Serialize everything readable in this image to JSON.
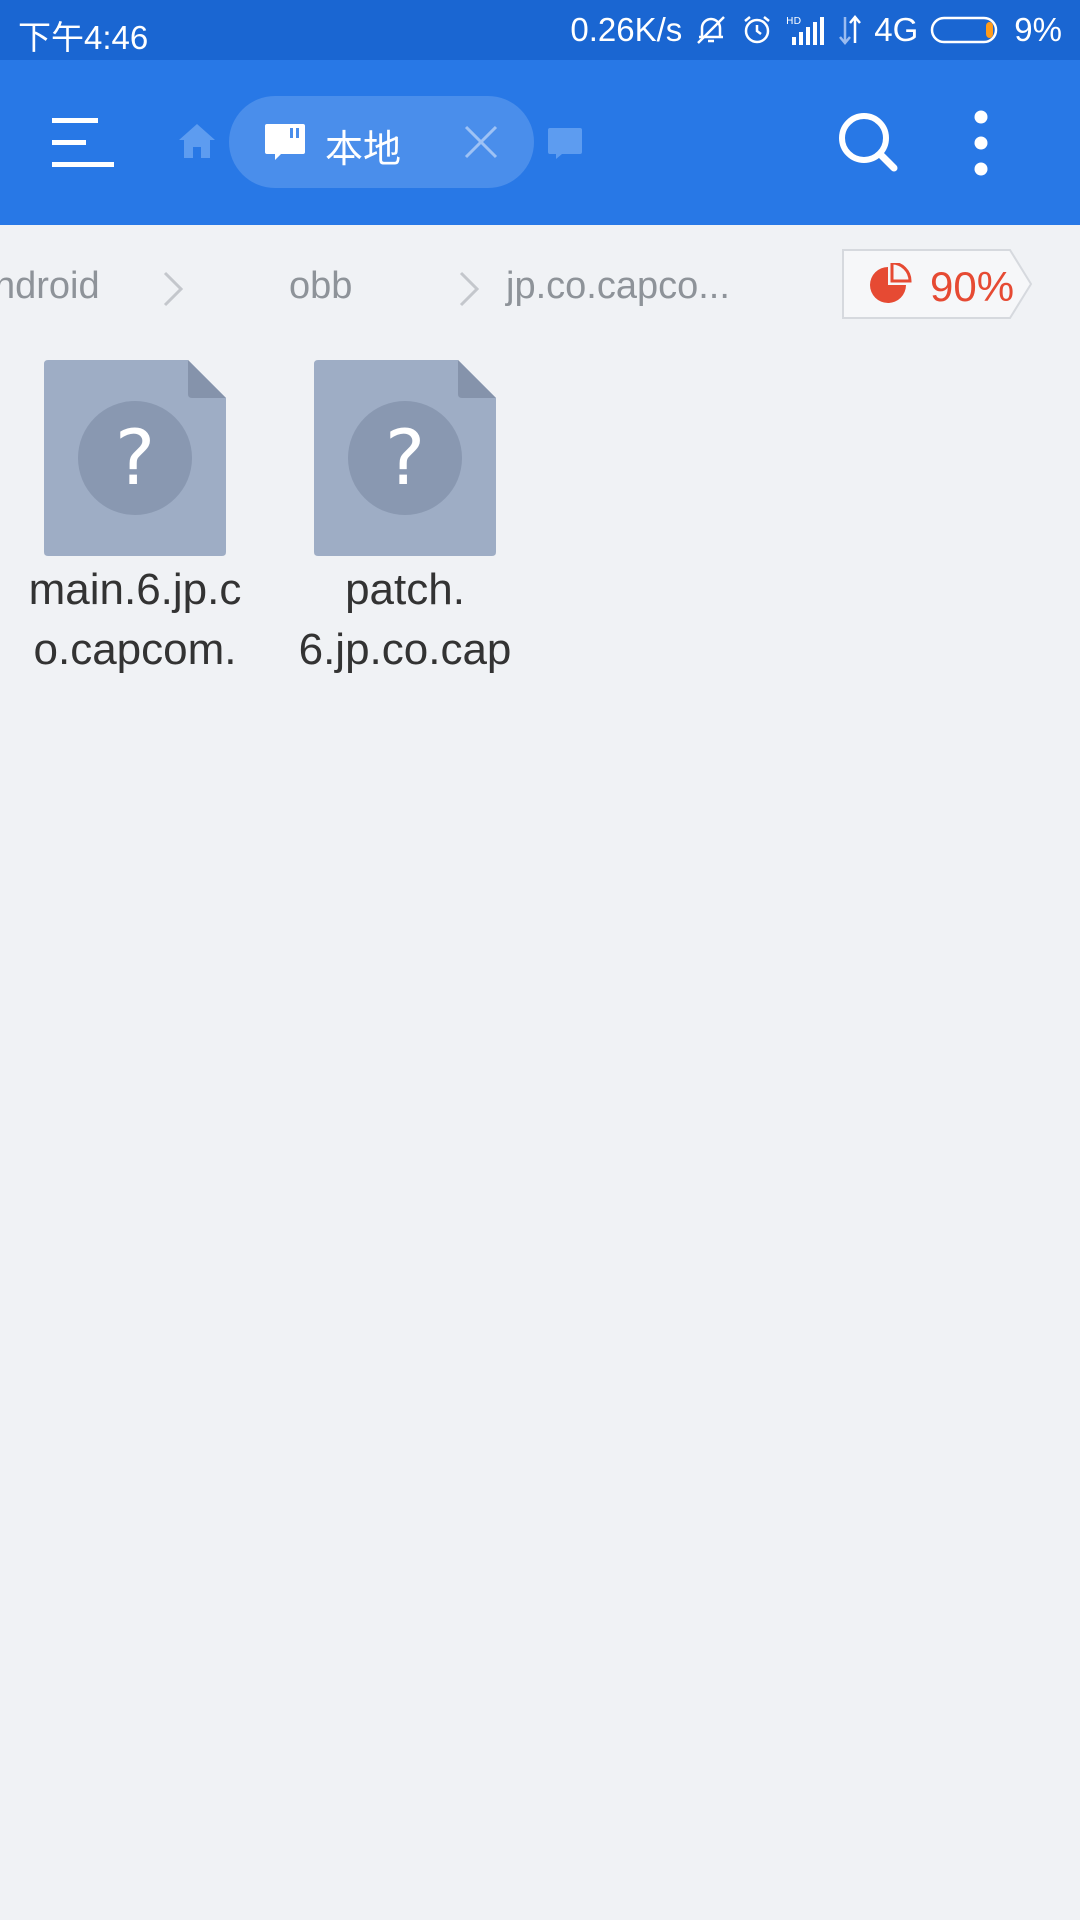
{
  "status_bar": {
    "time": "下午4:46",
    "net_speed": "0.26K/s",
    "network_type": "4G",
    "battery": "9%",
    "icons": [
      "mute-bell-icon",
      "alarm-icon",
      "hd-signal-icon",
      "data-arrows-icon",
      "battery-icon"
    ]
  },
  "toolbar": {
    "tab_label": "本地",
    "icons": [
      "menu-icon",
      "home-icon",
      "sd-card-icon",
      "close-icon",
      "search-icon",
      "more-vert-icon"
    ],
    "accent_color": "#2878e6"
  },
  "breadcrumb": {
    "items": [
      "ndroid",
      "obb",
      "jp.co.capco..."
    ],
    "storage_used": "90%",
    "storage_color": "#e64a33"
  },
  "files": [
    {
      "name_line1": "main.6.jp.c",
      "name_line2": "o.capcom.",
      "icon": "unknown-file-icon"
    },
    {
      "name_line1": "patch.",
      "name_line2": "6.jp.co.cap",
      "icon": "unknown-file-icon"
    }
  ]
}
